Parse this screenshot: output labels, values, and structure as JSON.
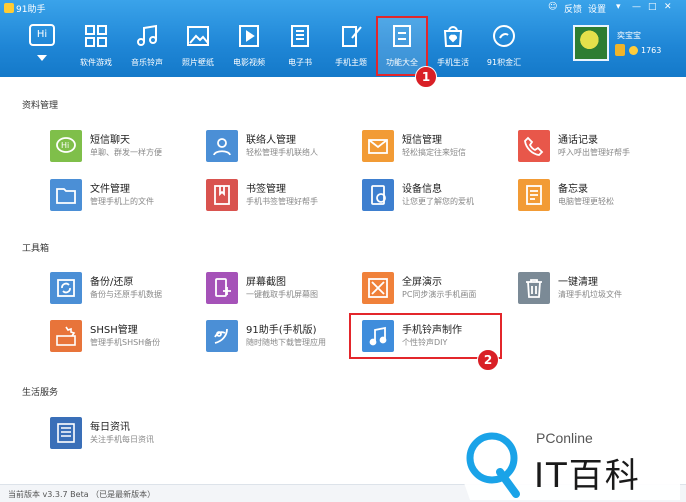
{
  "window": {
    "title": "91助手",
    "controls": {
      "feedback": "反馈",
      "settings": "设置"
    }
  },
  "nav": {
    "items": [
      {
        "label": "软件游戏",
        "icon": "apps-grid-icon"
      },
      {
        "label": "音乐铃声",
        "icon": "music-note-icon"
      },
      {
        "label": "照片壁纸",
        "icon": "picture-icon"
      },
      {
        "label": "电影视频",
        "icon": "video-play-icon"
      },
      {
        "label": "电子书",
        "icon": "ebook-icon"
      },
      {
        "label": "手机主题",
        "icon": "theme-brush-icon"
      },
      {
        "label": "功能大全",
        "icon": "feature-list-icon",
        "active": true
      },
      {
        "label": "手机生活",
        "icon": "shopping-bag-icon"
      },
      {
        "label": "91积金汇",
        "icon": "piggy-bank-icon"
      }
    ],
    "hi_label": "Hi"
  },
  "user": {
    "name": "奕宝宝",
    "points": "1763"
  },
  "sections": [
    {
      "title": "资料管理",
      "items": [
        {
          "name": "短信聊天",
          "desc": "单聊、群发一样方便",
          "color": "#7fbf4a",
          "icon": "hi-bubble-icon"
        },
        {
          "name": "联络人管理",
          "desc": "轻松管理手机联络人",
          "color": "#4b8fd6",
          "icon": "contact-person-icon"
        },
        {
          "name": "短信管理",
          "desc": "轻松搞定往来短信",
          "color": "#f29b35",
          "icon": "envelope-icon"
        },
        {
          "name": "通话记录",
          "desc": "呼入呼出管理好帮手",
          "color": "#e8574a",
          "icon": "phone-handset-icon"
        },
        {
          "name": "文件管理",
          "desc": "管理手机上的文件",
          "color": "#4b8fd6",
          "icon": "folder-icon"
        },
        {
          "name": "书签管理",
          "desc": "手机书签管理好帮手",
          "color": "#d9534f",
          "icon": "bookmark-icon"
        },
        {
          "name": "设备信息",
          "desc": "让您更了解您的爱机",
          "color": "#3e7fcf",
          "icon": "device-info-icon"
        },
        {
          "name": "备忘录",
          "desc": "电脑管理更轻松",
          "color": "#f29b35",
          "icon": "memo-icon"
        }
      ]
    },
    {
      "title": "工具箱",
      "items": [
        {
          "name": "备份/还原",
          "desc": "备份与还原手机数据",
          "color": "#4b8fd6",
          "icon": "backup-restore-icon"
        },
        {
          "name": "屏幕截图",
          "desc": "一键截取手机屏幕图",
          "color": "#a552b8",
          "icon": "screenshot-icon"
        },
        {
          "name": "全屏演示",
          "desc": "PC同步演示手机画面",
          "color": "#f0813a",
          "icon": "fullscreen-icon"
        },
        {
          "name": "一键清理",
          "desc": "清理手机垃圾文件",
          "color": "#7b8a96",
          "icon": "trash-can-icon"
        },
        {
          "name": "SHSH管理",
          "desc": "管理手机SHSH备份",
          "color": "#e8743a",
          "icon": "shsh-cert-icon"
        },
        {
          "name": "91助手(手机版)",
          "desc": "随时随地下载管理应用",
          "color": "#4b8fd6",
          "icon": "assistant-91-icon"
        },
        {
          "name": "手机铃声制作",
          "desc": "个性铃声DIY",
          "color": "#3f8ddc",
          "icon": "ringtone-note-icon"
        }
      ]
    },
    {
      "title": "生活服务",
      "items": [
        {
          "name": "每日资讯",
          "desc": "关注手机每日资讯",
          "color": "#3a6fb8",
          "icon": "news-paper-icon"
        }
      ]
    }
  ],
  "markers": [
    "1",
    "2"
  ],
  "status": {
    "version": "当前版本 v3.3.7 Beta （已是最新版本）"
  },
  "watermark": {
    "brand": "PConline",
    "logo_text": "IT百科"
  }
}
